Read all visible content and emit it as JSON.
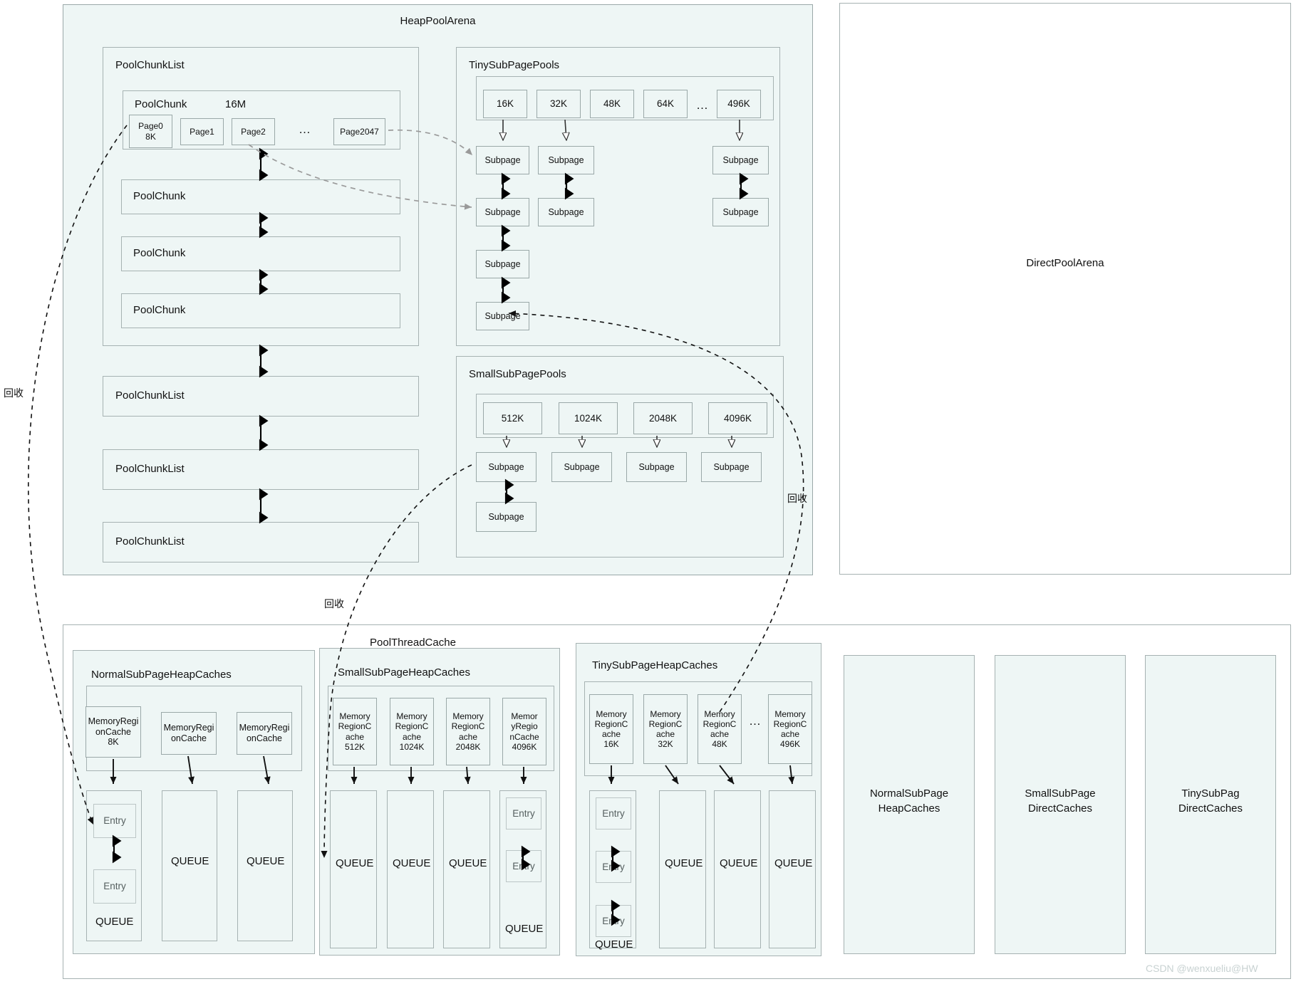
{
  "meta": {
    "watermark": "CSDN @wenxueliu@HW"
  },
  "heap_pool_arena": {
    "title": "HeapPoolArena",
    "pool_chunk_list": {
      "title": "PoolChunkList",
      "chunks": [
        {
          "label": "PoolChunk",
          "size": "16M",
          "pages": [
            "Page0",
            "8K",
            "Page1",
            "Page2",
            "…",
            "Page2047"
          ],
          "page_boxes": [
            {
              "line1": "Page0",
              "line2": "8K"
            },
            {
              "line1": "Page1",
              "line2": ""
            },
            {
              "line1": "Page2",
              "line2": ""
            },
            {
              "line1": "Page2047",
              "line2": ""
            }
          ],
          "ellipsis": "…"
        },
        {
          "label": "PoolChunk"
        },
        {
          "label": "PoolChunk"
        },
        {
          "label": "PoolChunk"
        }
      ]
    },
    "other_chunk_lists": [
      {
        "label": "PoolChunkList"
      },
      {
        "label": "PoolChunkList"
      },
      {
        "label": "PoolChunkList"
      }
    ],
    "tiny_sub_page_pools": {
      "title": "TinySubPagePools",
      "sizes": [
        "16K",
        "32K",
        "48K",
        "64K",
        "496K"
      ],
      "ellipsis": "…",
      "subpage_label": "Subpage",
      "columns": [
        {
          "size": "16K",
          "count": 4
        },
        {
          "size": "32K",
          "count": 2
        },
        {
          "size": "496K",
          "count": 2
        }
      ]
    },
    "small_sub_page_pools": {
      "title": "SmallSubPagePools",
      "sizes": [
        "512K",
        "1024K",
        "2048K",
        "4096K"
      ],
      "subpage_label": "Subpage",
      "columns": [
        {
          "size": "512K",
          "count": 2
        },
        {
          "size": "1024K",
          "count": 1
        },
        {
          "size": "2048K",
          "count": 1
        },
        {
          "size": "4096K",
          "count": 1
        }
      ]
    }
  },
  "direct_pool_arena": {
    "title": "DirectPoolArena"
  },
  "pool_thread_cache": {
    "title": "PoolThreadCache",
    "normal_sub_page_heap_caches": {
      "title": "NormalSubPageHeapCaches",
      "caches": [
        {
          "line1": "MemoryRegi",
          "line2": "onCache",
          "line3": "8K"
        },
        {
          "line1": "MemoryRegi",
          "line2": "onCache",
          "line3": ""
        },
        {
          "line1": "MemoryRegi",
          "line2": "onCache",
          "line3": ""
        }
      ],
      "queues": [
        {
          "label": "QUEUE",
          "entries": [
            "Entry",
            "Entry"
          ]
        },
        {
          "label": "QUEUE",
          "entries": []
        },
        {
          "label": "QUEUE",
          "entries": []
        }
      ]
    },
    "small_sub_page_heap_caches": {
      "title": "SmallSubPageHeapCaches",
      "caches": [
        {
          "line1": "Memory",
          "line2": "RegionC",
          "line3": "ache",
          "line4": "512K"
        },
        {
          "line1": "Memory",
          "line2": "RegionC",
          "line3": "ache",
          "line4": "1024K"
        },
        {
          "line1": "Memory",
          "line2": "RegionC",
          "line3": "ache",
          "line4": "2048K"
        },
        {
          "line1": "Memor",
          "line2": "yRegio",
          "line3": "nCache",
          "line4": "4096K"
        }
      ],
      "queues": [
        {
          "label": "QUEUE",
          "entries": []
        },
        {
          "label": "QUEUE",
          "entries": []
        },
        {
          "label": "QUEUE",
          "entries": []
        },
        {
          "label": "QUEUE",
          "entries": [
            "Entry",
            "Entry"
          ]
        }
      ]
    },
    "tiny_sub_page_heap_caches": {
      "title": "TinySubPageHeapCaches",
      "ellipsis": "…",
      "caches": [
        {
          "line1": "Memory",
          "line2": "RegionC",
          "line3": "ache",
          "line4": "16K"
        },
        {
          "line1": "Memory",
          "line2": "RegionC",
          "line3": "ache",
          "line4": "32K"
        },
        {
          "line1": "Memory",
          "line2": "RegionC",
          "line3": "ache",
          "line4": "48K"
        },
        {
          "line1": "Memory",
          "line2": "RegionC",
          "line3": "ache",
          "line4": "496K"
        }
      ],
      "queues": [
        {
          "label": "QUEUE",
          "entries": [
            "Entry",
            "Entry",
            "Entry"
          ]
        },
        {
          "label": "QUEUE",
          "entries": []
        },
        {
          "label": "QUEUE",
          "entries": []
        },
        {
          "label": "QUEUE",
          "entries": []
        }
      ]
    },
    "other_caches": [
      {
        "line1": "NormalSubPage",
        "line2": "HeapCaches"
      },
      {
        "line1": "SmallSubPage",
        "line2": "DirectCaches"
      },
      {
        "line1": "TinySubPag",
        "line2": "DirectCaches"
      }
    ]
  },
  "annotations": {
    "recycle_left": "回收",
    "recycle_mid": "回收",
    "recycle_right": "回收"
  }
}
